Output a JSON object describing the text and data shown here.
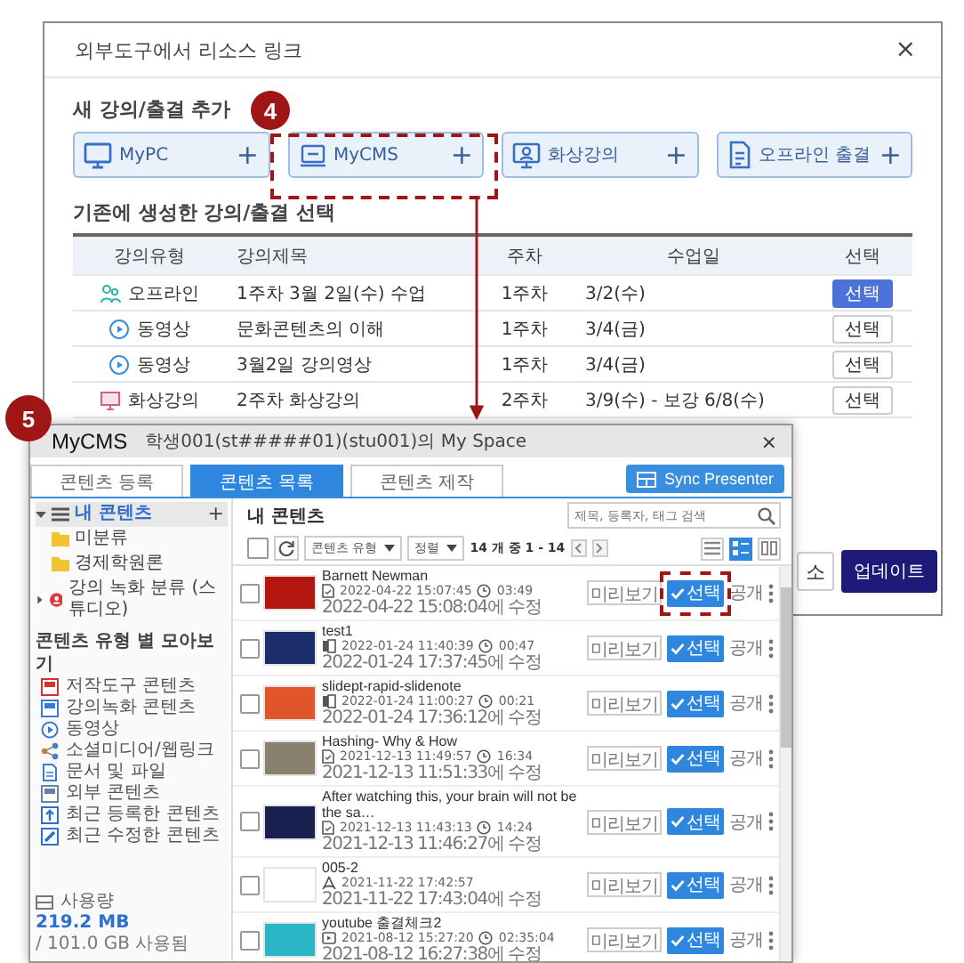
{
  "dialog": {
    "title": "외부도구에서 리소스 링크",
    "close": "×",
    "new_section": {
      "heading": "새 강의/출결 추가",
      "sources": [
        {
          "kind": "pc",
          "label": "MyPC",
          "plus": "+"
        },
        {
          "kind": "cms",
          "label": "MyCMS",
          "plus": "+"
        },
        {
          "kind": "live",
          "label": "화상강의",
          "plus": "+"
        },
        {
          "kind": "offline",
          "label": "오프라인 출결",
          "plus": "+"
        }
      ]
    },
    "existing_section": {
      "heading": "기존에 생성한 강의/출결 선택",
      "columns": [
        "강의유형",
        "강의제목",
        "주차",
        "수업일",
        "선택"
      ],
      "rows": [
        {
          "kind": "offline",
          "type": "오프라인",
          "title": "1주차 3월 2일(수) 수업",
          "week": "1주차",
          "date": "3/2(수)",
          "action": "선택",
          "selected": true
        },
        {
          "kind": "video",
          "type": "동영상",
          "title": "문화콘텐츠의 이해",
          "week": "1주차",
          "date": "3/4(금)",
          "action": "선택",
          "selected": false
        },
        {
          "kind": "video",
          "type": "동영상",
          "title": "3월2일 강의영상",
          "week": "1주차",
          "date": "3/4(금)",
          "action": "선택",
          "selected": false
        },
        {
          "kind": "live",
          "type": "화상강의",
          "title": "2주차 화상강의",
          "week": "2주차",
          "date": "3/9(수) - 보강 6/8(수)",
          "action": "선택",
          "selected": false
        }
      ]
    },
    "footer": [
      {
        "kind": "secondary",
        "label": "소"
      },
      {
        "kind": "primary",
        "label": "업데이트"
      }
    ]
  },
  "annotations": [
    {
      "number": "4"
    },
    {
      "number": "5"
    }
  ],
  "mycms": {
    "title": "MyCMS",
    "subtitle": "학생001(st#####01)(stu001)의 My Space",
    "close": "×",
    "tabs": [
      {
        "label": "콘텐츠 등록",
        "selected": false
      },
      {
        "label": "콘텐츠 목록",
        "selected": true
      },
      {
        "label": "콘텐츠 제작",
        "selected": false
      }
    ],
    "sync_button": "Sync Presenter",
    "sidebar": {
      "tree": [
        {
          "label": "내 콘텐츠",
          "kind": "list",
          "selected": true,
          "expanded": true,
          "add": "+",
          "children": [
            {
              "label": "미분류",
              "kind": "folder",
              "selected": false
            },
            {
              "label": "경제학원론",
              "kind": "folder",
              "selected": false
            }
          ]
        },
        {
          "label": "강의 녹화 분류 (스튜디오)",
          "kind": "studio",
          "selected": false,
          "expanded": false
        }
      ],
      "types_heading": "콘텐츠 유형 별 모아보기",
      "types": [
        {
          "kind": "authoring",
          "label": "저작도구 콘텐츠"
        },
        {
          "kind": "recording",
          "label": "강의녹화 콘텐츠"
        },
        {
          "kind": "video",
          "label": "동영상"
        },
        {
          "kind": "social",
          "label": "소셜미디어/웹링크"
        },
        {
          "kind": "document",
          "label": "문서 및 파일"
        },
        {
          "kind": "external",
          "label": "외부 콘텐츠"
        },
        {
          "kind": "recent-upload",
          "label": "최근 등록한 콘텐츠"
        },
        {
          "kind": "recent-edit",
          "label": "최근 수정한 콘텐츠"
        }
      ],
      "usage": {
        "label": "사용량",
        "used": "219.2 MB",
        "total": "/ 101.0 GB 사용됨"
      }
    },
    "list": {
      "heading": "내 콘텐츠",
      "select_all_checked": false,
      "search_placeholder": "제목, 등록자, 태그 검색",
      "filters": [
        "콘텐츠 유형",
        "정렬"
      ],
      "count": "14 개 중 1 - 14",
      "views": [
        {
          "kind": "list",
          "selected": false
        },
        {
          "kind": "grid",
          "selected": true
        },
        {
          "kind": "columns",
          "selected": false
        }
      ],
      "rows": [
        {
          "kind": "document",
          "title": "Barnett Newman",
          "created": "2022-04-22 15:07:45",
          "duration": "03:49",
          "modified": "2022-04-22 15:08:04에 수정",
          "checked": false,
          "highlighted": true,
          "preview": "미리보기",
          "select": "선택",
          "visibility": "공개"
        },
        {
          "kind": "slides",
          "title": "test1",
          "created": "2022-01-24 11:40:39",
          "duration": "00:47",
          "modified": "2022-01-24 17:37:45에 수정",
          "checked": false,
          "highlighted": false,
          "preview": "미리보기",
          "select": "선택",
          "visibility": "공개"
        },
        {
          "kind": "slides",
          "title": "slidept-rapid-slidenote",
          "created": "2022-01-24 11:00:27",
          "duration": "00:21",
          "modified": "2022-01-24 17:36:12에 수정",
          "checked": false,
          "highlighted": false,
          "preview": "미리보기",
          "select": "선택",
          "visibility": "공개"
        },
        {
          "kind": "document",
          "title": "Hashing- Why & How",
          "created": "2021-12-13 11:49:57",
          "duration": "16:34",
          "modified": "2021-12-13 11:51:33에 수정",
          "checked": false,
          "highlighted": false,
          "preview": "미리보기",
          "select": "선택",
          "visibility": "공개"
        },
        {
          "kind": "document",
          "title": "After watching this, your brain will not be the sa…",
          "created": "2021-12-13 11:43:13",
          "duration": "14:24",
          "modified": "2021-12-13 11:46:27에 수정",
          "checked": false,
          "highlighted": false,
          "preview": "미리보기",
          "select": "선택",
          "visibility": "공개"
        },
        {
          "kind": "pdf",
          "title": "005-2",
          "created": "2021-11-22 17:42:57",
          "modified": "2021-11-22 17:43:04에 수정",
          "checked": false,
          "highlighted": false,
          "preview": "미리보기",
          "select": "선택",
          "visibility": "공개"
        },
        {
          "kind": "video",
          "title": "youtube 출결체크2",
          "created": "2021-08-12 15:27:20",
          "duration": "02:35:04",
          "modified": "2021-08-12 16:27:38에 수정",
          "checked": false,
          "highlighted": false,
          "preview": "미리보기",
          "select": "선택",
          "visibility": "공개"
        }
      ]
    }
  }
}
